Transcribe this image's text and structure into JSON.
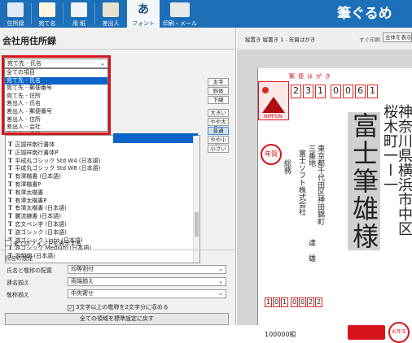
{
  "toolbar": {
    "buttons": [
      {
        "label": "住所録",
        "icon": "address-book-icon"
      },
      {
        "label": "宛て名",
        "icon": "address-card-icon"
      },
      {
        "label": "用 紙",
        "icon": "paper-icon"
      },
      {
        "label": "差出人",
        "icon": "sender-icon"
      },
      {
        "label": "フォント",
        "icon": "font-icon",
        "icon_text": "あ",
        "active": true
      },
      {
        "label": "印刷・メール",
        "icon": "printer-icon"
      }
    ],
    "brand": "筆ぐるめ",
    "color": "#1d6fb8"
  },
  "left_panel": {
    "title": "会社用住所録",
    "target_select": {
      "value": "宛て先 - 氏名"
    },
    "dropdown_options": [
      "全ての項目",
      "宛て先 - 氏名",
      "宛て先 - 郵便番号",
      "宛て先 - 住所",
      "差出人 - 氏名",
      "差出人 - 郵便番号",
      "差出人 - 住所",
      "差出人 - 会社",
      "差出人 - 役職",
      "差出人 - その他"
    ],
    "dropdown_selected_index": 1,
    "font_list": [
      "正調祥南行書体",
      "正調祥南行書体P",
      "平成丸ゴシック Std W4 (日本語)",
      "平成丸ゴシック Std W8 (日本語)",
      "有澤楷書 (日本語)",
      "有澤楷書P",
      "有澤太楷書",
      "有澤太楷書P",
      "有澤太楷書 (日本語)",
      "麗流隷書 (日本語)",
      "恋文ペン字 (日本語)",
      "游ゴシック (日本語)",
      "游ゴシック Light (日本語)",
      "游ゴシック Medium (日本語)",
      "游明朝 (日本語)"
    ],
    "size_buttons": [
      "太字",
      "斜体",
      "下線",
      "大きい",
      "やや大きい",
      "普通",
      "やや小さい",
      "小さい"
    ],
    "size_active_index": 5,
    "show_all_fonts": "全てのフォントを表示する",
    "settings_heading": "氏名の設定",
    "settings": [
      {
        "label": "氏名と敬称の配置",
        "value": "均等割付"
      },
      {
        "label": "連名揃え",
        "value": "両端揃え"
      },
      {
        "label": "敬称揃え",
        "value": "中央寄せ"
      }
    ],
    "honorific_checkbox": "3文字以上の敬称を2文字分に収める",
    "reset_button": "全ての領域を標準設定に戻す"
  },
  "preview": {
    "info": "縦置き 縦書き 1 - 年賀はがき",
    "print_label": "すぐ印刷",
    "view_select": "全体を表示",
    "postcard_title": "郵便はがき",
    "zip_digits": [
      "2",
      "3",
      "1",
      "0",
      "0",
      "6",
      "1"
    ],
    "stamp_label": "NIPPON",
    "nenga_label": "年賀",
    "address_line1": "神奈川県横浜市中区",
    "address_line2": "桜木町一ー一",
    "recipient": "富士筆雄様",
    "sender_address1": "東京都千代田区神田錦町",
    "sender_address2": "三番地",
    "sender_company": "富士ソフト株式会社",
    "sender_kana": "総務",
    "sender_name": "達 雄",
    "sender_zip": [
      "1",
      "0",
      "1",
      "0",
      "0",
      "2",
      "2"
    ],
    "lottery_label": "100000組",
    "lottery_banner": "お年玉",
    "accent_color": "#d8131b"
  }
}
